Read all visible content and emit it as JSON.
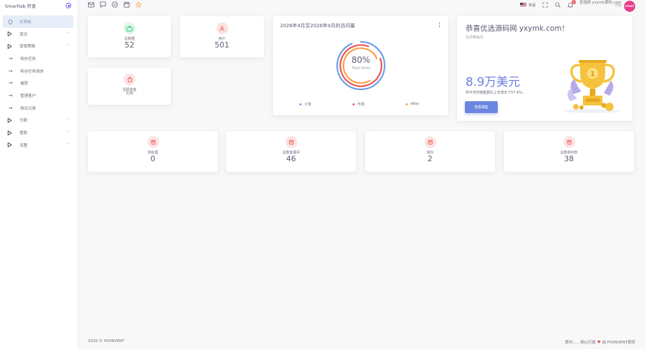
{
  "sidebar": {
    "brand": "Smartlab 开发",
    "items": [
      {
        "label": "仪表板",
        "active": true
      },
      {
        "label": "资讯"
      },
      {
        "label": "促销策略"
      },
      {
        "label": "特办任务"
      },
      {
        "label": "特办任务请求"
      },
      {
        "label": "捕获"
      },
      {
        "label": "管理客户"
      },
      {
        "label": "购买记录"
      },
      {
        "label": "付款"
      },
      {
        "label": "提款"
      },
      {
        "label": "设置"
      }
    ]
  },
  "topbar": {
    "language": "英语",
    "notification_count": "6",
    "user_name": "优选网 yxymk源码.com",
    "user_role": "行政",
    "avatar_text": "START"
  },
  "stats_top": [
    {
      "label": "总数据",
      "value": "52"
    },
    {
      "label": "用户",
      "value": "501"
    }
  ],
  "stats_small": {
    "label": "活跃资金",
    "sub": "礼物"
  },
  "visits": {
    "title": "2026年4月至2026年4月的访问量",
    "percent": "80%",
    "caption": "Total Visits",
    "legend": [
      "订单",
      "市场",
      "eBay"
    ]
  },
  "congrats": {
    "title": "恭喜优选源码网 yxymk.com！",
    "subtitle": "当月畅销书",
    "amount": "8.9万美元",
    "note": "你今天的销售额比上年增长了57.6%。",
    "button": "查看销售"
  },
  "stats_bottom": [
    {
      "label": "待处理",
      "value": "0"
    },
    {
      "label": "总数客服问",
      "value": "46"
    },
    {
      "label": "待办",
      "value": "2"
    },
    {
      "label": "总数库存款",
      "value": "38"
    }
  ],
  "footer": {
    "left": "2020 © PIXINVENT",
    "right_prefix": "爱问……用心打造",
    "right_suffix": "由 PIXINVENT提供"
  },
  "colors": {
    "success": "#28c76f",
    "danger": "#ea5455",
    "primary": "#6b86e0",
    "warning": "#ff9f43",
    "info": "#6e9ee8"
  }
}
